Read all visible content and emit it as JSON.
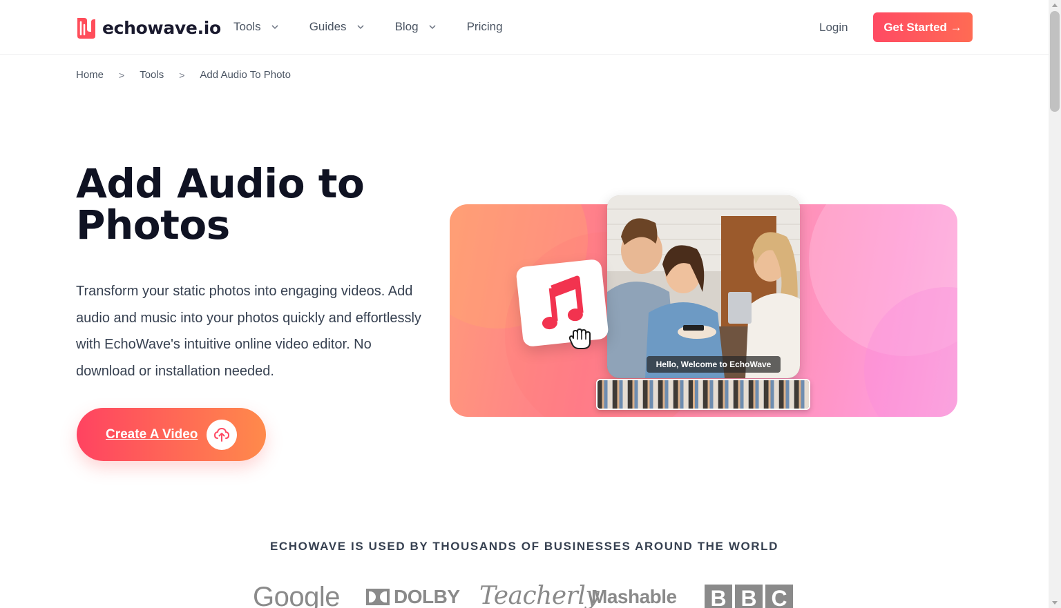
{
  "header": {
    "logo_text": "echowave.io",
    "nav": [
      {
        "label": "Tools",
        "has_dropdown": true
      },
      {
        "label": "Guides",
        "has_dropdown": true
      },
      {
        "label": "Blog",
        "has_dropdown": true
      },
      {
        "label": "Pricing",
        "has_dropdown": false
      }
    ],
    "login_label": "Login",
    "cta_label": "Get Started →"
  },
  "breadcrumb": [
    "Home",
    "Tools",
    "Add Audio To Photo"
  ],
  "hero": {
    "title": "Add Audio to Photos",
    "description": "Transform your static photos into engaging videos. Add audio and music into your photos quickly and effortlessly with EchoWave's intuitive online video editor. No download or installation needed.",
    "cta_label": "Create A Video",
    "video_caption": "Hello, Welcome to EchoWave"
  },
  "trust": {
    "heading": "ECHOWAVE IS USED BY THOUSANDS OF BUSINESSES AROUND THE WORLD",
    "logos": [
      "Google",
      "DOLBY",
      "Teacherly",
      "Mashable",
      "BBC"
    ]
  },
  "colors": {
    "accent": "#ff4a63",
    "accent_end": "#ff8a4b",
    "heading": "#0f1222",
    "body_text": "#374151"
  },
  "icons": {
    "logo": "echowave-logo-icon",
    "chevron": "chevron-down-icon",
    "upload": "upload-cloud-icon",
    "music": "music-note-icon",
    "hand": "hand-pointer-icon"
  }
}
